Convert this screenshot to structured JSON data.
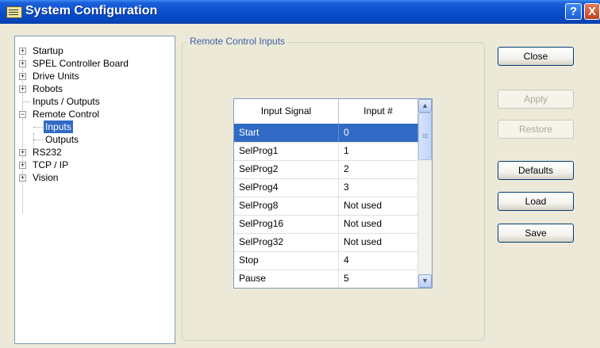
{
  "window": {
    "title": "System Configuration",
    "help_label": "?",
    "close_label": "X"
  },
  "tree": {
    "items": [
      {
        "label": "Startup",
        "expander": "+"
      },
      {
        "label": "SPEL Controller Board",
        "expander": "+"
      },
      {
        "label": "Drive Units",
        "expander": "+"
      },
      {
        "label": "Robots",
        "expander": "+"
      },
      {
        "label": "Inputs / Outputs",
        "expander": ""
      },
      {
        "label": "Remote Control",
        "expander": "−"
      },
      {
        "label": "Inputs",
        "expander": ""
      },
      {
        "label": "Outputs",
        "expander": ""
      },
      {
        "label": "RS232",
        "expander": "+"
      },
      {
        "label": "TCP / IP",
        "expander": "+"
      },
      {
        "label": "Vision",
        "expander": "+"
      }
    ],
    "selected": "Inputs"
  },
  "group": {
    "title": "Remote Control Inputs"
  },
  "grid": {
    "columns": [
      "Input Signal",
      "Input #"
    ],
    "rows": [
      [
        "Start",
        "0"
      ],
      [
        "SelProg1",
        "1"
      ],
      [
        "SelProg2",
        "2"
      ],
      [
        "SelProg4",
        "3"
      ],
      [
        "SelProg8",
        "Not used"
      ],
      [
        "SelProg16",
        "Not used"
      ],
      [
        "SelProg32",
        "Not used"
      ],
      [
        "Stop",
        "4"
      ],
      [
        "Pause",
        "5"
      ]
    ],
    "selected_row": 0
  },
  "buttons": {
    "close": "Close",
    "apply": "Apply",
    "restore": "Restore",
    "defaults": "Defaults",
    "load": "Load",
    "save": "Save"
  },
  "colors": {
    "titlebar": "#0A4FCF",
    "selection": "#316AC5",
    "window_bg": "#ECE9D8"
  },
  "icons": {
    "window": "keyboard-icon",
    "help": "help-icon",
    "close": "close-icon"
  }
}
